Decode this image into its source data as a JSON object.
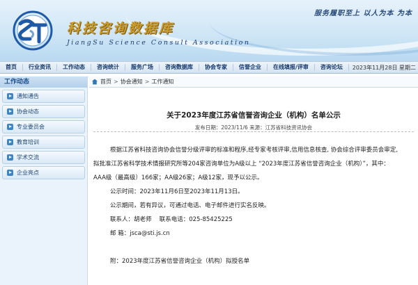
{
  "header": {
    "title": "科技咨询数据库",
    "subtitle": "JiangSu Science Consult Association",
    "slogan": "服务履职至上 以人为本 为本"
  },
  "nav": {
    "items": [
      "首页",
      "行业资讯",
      "工作动态",
      "咨询统计",
      "服务广场",
      "咨询数据库",
      "协会专家",
      "信誉企业",
      "在线填报/评审",
      "咨询论坛"
    ],
    "date": "2023年11月28日 星期二"
  },
  "sidebar": {
    "title": "工作动态",
    "items": [
      "通知通告",
      "协会动态",
      "专业委员会",
      "教育培训",
      "学术交流",
      "企业亮点"
    ]
  },
  "breadcrumb": {
    "home": "首页",
    "level1": "协会通知",
    "level2": "工作通知",
    "sep": ">"
  },
  "article": {
    "title": "关于2023年度江苏省信誉咨询企业（机构）名单公示",
    "meta": "发布日期：2023/11/6  来源：江苏省科技资讯协会",
    "para1_line1": "根据江苏省科技咨询协会信誉分级评审的标准和程序,经专家考核评审,信用信息核查, 协会综合评审委员会审定,",
    "para1_line2": "拟批准江苏省科学技术情报研究所等204家咨询单位为A级以上 “2023年度江苏省信誉咨询企业（机构）”，其中：",
    "para1_line3": "AAA级（最高级）166家；AA级26家；A级12家，现予以公示。",
    "period": "公示时间：2023年11月6日至2023年11月13日。",
    "objection": "公示期间，若有异议，可通过电话、电子邮件进行实名反映。",
    "contact": "联系人：胡老师　 联系电话：025-85425225",
    "email": "邮  箱：jsca@sti.js.cn",
    "attachment": "附：2023年度江苏省信誉咨询企业（机构）拟授名单"
  },
  "colors": {
    "nav_text": "#14386e",
    "title_gold": "#c99a2e",
    "accent_blue": "#3e85c6"
  }
}
